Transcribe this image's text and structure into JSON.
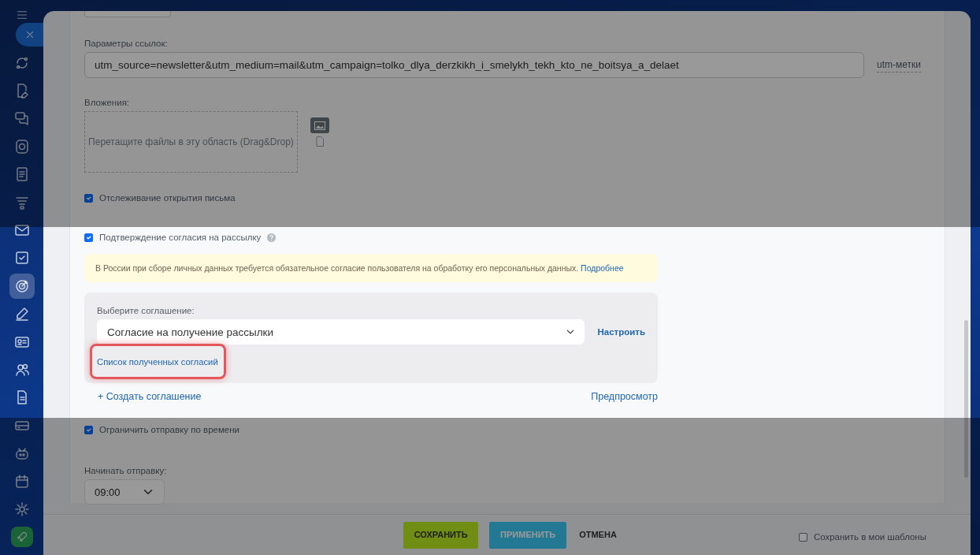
{
  "sidebar": {
    "items": [
      {
        "selected": false
      },
      {
        "selected": false
      },
      {
        "selected": false
      },
      {
        "selected": false
      },
      {
        "selected": false
      },
      {
        "selected": false
      },
      {
        "selected": false
      },
      {
        "selected": false
      },
      {
        "selected": true
      },
      {
        "selected": false
      },
      {
        "selected": false
      },
      {
        "selected": false
      },
      {
        "selected": false
      },
      {
        "selected": false
      },
      {
        "selected": false
      },
      {
        "selected": false
      },
      {
        "selected": false
      }
    ]
  },
  "link_params": {
    "label": "Параметры ссылок:",
    "value": "utm_source=newsletter&utm_medium=mail&utm_campaign=tolko_dlya_derzkikh_i_smelykh_tekh_kto_ne_boitsya_a_delaet",
    "hint_link": "utm-метки"
  },
  "attachments": {
    "label": "Вложения:",
    "dropzone": "Перетащите файлы в эту область (Drag&Drop)"
  },
  "track_opening": {
    "label": "Отслеживание открытия письма",
    "checked": true
  },
  "consent": {
    "label": "Подтверждение согласия на рассылку",
    "checked": true,
    "notice": "В России при сборе личных данных требуется обязательное согласие пользователя на обработку его персональных данных.",
    "notice_link": "Подробнее",
    "select_label": "Выберите соглашение:",
    "select_value": "Согласие на получение рассылки",
    "configure": "Настроить",
    "list_link": {
      "text": "Список полученных согласий",
      "highlighted": true
    },
    "create_link": "+ Создать соглашение",
    "preview_link": "Предпросмотр"
  },
  "time_limit": {
    "label": "Ограничить отправку по времени",
    "checked": true,
    "start_label": "Начинать отправку:",
    "start_value": "09:00"
  },
  "footer": {
    "save": "СОХРАНИТЬ",
    "apply": "ПРИМЕНИТЬ",
    "cancel": "ОТМЕНА",
    "template": {
      "label": "Сохранить в мои шаблоны",
      "checked": false
    }
  }
}
